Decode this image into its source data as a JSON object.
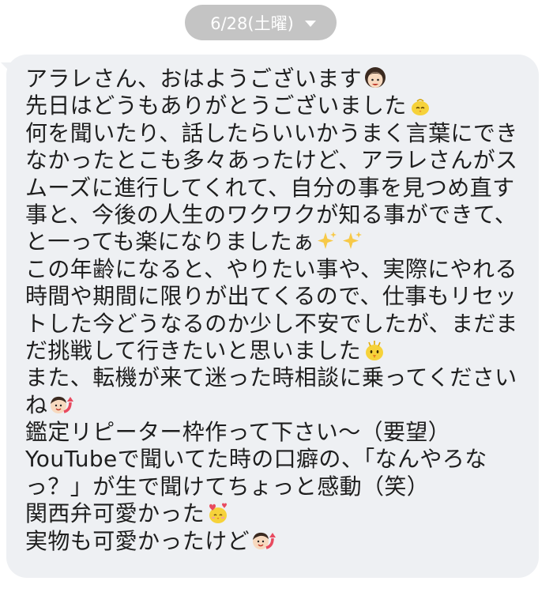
{
  "date_header": {
    "label": "6/28(土曜)"
  },
  "message": {
    "lines": [
      "アラレさん、おはようございます",
      "先日はどうもありがとうございました",
      "何を聞いたり、話したらいいかうまく言葉にでき",
      "なかったとこも多々あったけど、アラレさんがス",
      "ムーズに進行してくれて、自分の事を見つめ直す",
      "事と、今後の人生のワクワクが知る事ができて、",
      "と一っても楽になりましたぁ",
      "この年齢になると、やりたい事や、実際にやれる",
      "時間や期間に限りが出てくるので、仕事もリセッ",
      "トした今どうなるのか少し不安でしたが、まだま",
      "だ挑戦して行きたいと思いました",
      "また、転機が来て迷った時相談に乗ってくださ",
      "ね",
      "鑑定リピーター枠作って下さい〜（要望）",
      "YouTubeで聞いてた時の口癖の、「なんやろな",
      "っ？」が生で聞けてちょっと感動（笑）",
      "関西弁可愛かった",
      "実物も可愛かったけど"
    ],
    "line_11_suffix": "い",
    "emojis": {
      "line_0": "woman-face-emoji",
      "line_1": "bowing-chick-emoji",
      "line_6": "sparkles-emoji",
      "line_10": "excited-chick-emoji",
      "line_12": "face-with-arrow-emoji",
      "line_16": "chick-with-hearts-emoji",
      "line_17": "face-with-arrow-emoji"
    }
  },
  "colors": {
    "date_pill_bg": "#c4c4c4",
    "bubble_bg": "#eef0f3",
    "text": "#1e1e1e"
  }
}
